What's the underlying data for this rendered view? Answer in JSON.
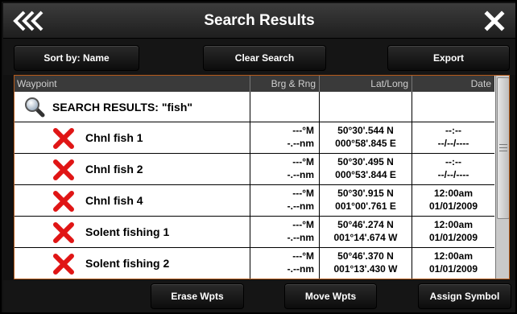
{
  "header": {
    "title": "Search Results",
    "back_icon": "double-chevron-left-icon",
    "close_icon": "close-icon"
  },
  "toolbar": {
    "sort_label": "Sort by: Name",
    "clear_label": "Clear Search",
    "export_label": "Export"
  },
  "table": {
    "columns": [
      "Waypoint",
      "Brg & Rng",
      "Lat/Long",
      "Date"
    ],
    "search_label": "SEARCH RESULTS: \"fish\"",
    "rows": [
      {
        "name": "Chnl fish 1",
        "brg": "---°M",
        "rng": "-.--nm",
        "lat": "50°30'.544 N",
        "lon": "000°58'.845 E",
        "time": "--:--",
        "date": "--/--/----"
      },
      {
        "name": "Chnl fish 2",
        "brg": "---°M",
        "rng": "-.--nm",
        "lat": "50°30'.495 N",
        "lon": "000°53'.844 E",
        "time": "--:--",
        "date": "--/--/----"
      },
      {
        "name": "Chnl fish 4",
        "brg": "---°M",
        "rng": "-.--nm",
        "lat": "50°30'.915 N",
        "lon": "001°00'.761 E",
        "time": "12:00am",
        "date": "01/01/2009"
      },
      {
        "name": "Solent fishing 1",
        "brg": "---°M",
        "rng": "-.--nm",
        "lat": "50°46'.274 N",
        "lon": "001°14'.674 W",
        "time": "12:00am",
        "date": "01/01/2009"
      },
      {
        "name": "Solent fishing 2",
        "brg": "---°M",
        "rng": "-.--nm",
        "lat": "50°46'.370 N",
        "lon": "001°13'.430 W",
        "time": "12:00am",
        "date": "01/01/2009"
      }
    ]
  },
  "footer": {
    "erase_label": "Erase Wpts",
    "move_label": "Move Wpts",
    "assign_label": "Assign Symbol"
  },
  "colors": {
    "accent_border": "#b65a1a",
    "waypoint_x": "#e01515",
    "header_bg": "#3a3a3a"
  }
}
